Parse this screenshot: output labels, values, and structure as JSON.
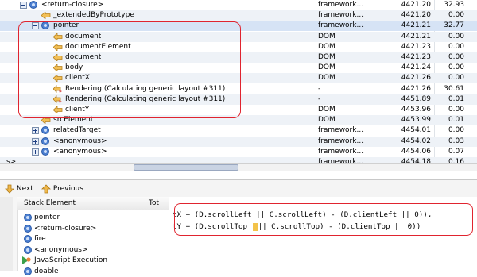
{
  "tree": {
    "rows": [
      {
        "level": 1,
        "expander": "minus",
        "icon": "function",
        "name": "<return-closure>",
        "type": "framework....",
        "time": "4421.20",
        "pct": "32.93",
        "alt": false
      },
      {
        "level": 2,
        "expander": "none",
        "icon": "arrow",
        "name": "_extendedByPrototype",
        "type": "framework....",
        "time": "4421.20",
        "pct": "0.00",
        "alt": true
      },
      {
        "level": 2,
        "expander": "minus",
        "icon": "function",
        "name": "pointer",
        "type": "framework....",
        "time": "4421.21",
        "pct": "32.77",
        "alt": false,
        "sel": true
      },
      {
        "level": 3,
        "expander": "none",
        "icon": "arrow",
        "name": "document",
        "type": "DOM",
        "time": "4421.21",
        "pct": "0.00",
        "alt": true
      },
      {
        "level": 3,
        "expander": "none",
        "icon": "arrow",
        "name": "documentElement",
        "type": "DOM",
        "time": "4421.23",
        "pct": "0.00",
        "alt": false
      },
      {
        "level": 3,
        "expander": "none",
        "icon": "arrow",
        "name": "document",
        "type": "DOM",
        "time": "4421.23",
        "pct": "0.00",
        "alt": true
      },
      {
        "level": 3,
        "expander": "none",
        "icon": "arrow",
        "name": "body",
        "type": "DOM",
        "time": "4421.24",
        "pct": "0.00",
        "alt": false
      },
      {
        "level": 3,
        "expander": "none",
        "icon": "arrow",
        "name": "clientX",
        "type": "DOM",
        "time": "4421.26",
        "pct": "0.00",
        "alt": true
      },
      {
        "level": 3,
        "expander": "none",
        "icon": "render",
        "name": "Rendering (Calculating generic layout #311)",
        "type": "-",
        "time": "4421.26",
        "pct": "30.61",
        "alt": false
      },
      {
        "level": 3,
        "expander": "none",
        "icon": "render",
        "name": "Rendering (Calculating generic layout #311)",
        "type": "-",
        "time": "4451.89",
        "pct": "0.01",
        "alt": true
      },
      {
        "level": 3,
        "expander": "none",
        "icon": "arrow",
        "name": "clientY",
        "type": "DOM",
        "time": "4453.96",
        "pct": "0.00",
        "alt": false
      },
      {
        "level": 2,
        "expander": "none",
        "icon": "arrow",
        "name": "srcElement",
        "type": "DOM",
        "time": "4453.99",
        "pct": "0.01",
        "alt": true
      },
      {
        "level": 2,
        "expander": "plus",
        "icon": "function",
        "name": "relatedTarget",
        "type": "framework....",
        "time": "4454.01",
        "pct": "0.00",
        "alt": false
      },
      {
        "level": 2,
        "expander": "plus",
        "icon": "function",
        "name": "<anonymous>",
        "type": "framework....",
        "time": "4454.02",
        "pct": "0.03",
        "alt": true
      },
      {
        "level": 2,
        "expander": "plus",
        "icon": "function",
        "name": "<anonymous>",
        "type": "framework....",
        "time": "4454.06",
        "pct": "0.07",
        "alt": false
      },
      {
        "level": 0,
        "expander": "none",
        "icon": "none",
        "name": "s>",
        "type": "framework....",
        "time": "4454.18",
        "pct": "0.16",
        "alt": true
      }
    ]
  },
  "toolbar": {
    "next_label": "Next",
    "previous_label": "Previous"
  },
  "stack": {
    "header_element": "Stack Element",
    "header_total": "Tot",
    "items": [
      {
        "icon": "function",
        "label": "pointer"
      },
      {
        "icon": "function",
        "label": "<return-closure>"
      },
      {
        "icon": "function",
        "label": "fire"
      },
      {
        "icon": "function",
        "label": "<anonymous>"
      },
      {
        "icon": "js-exec",
        "label": "JavaScript Execution"
      },
      {
        "icon": "function",
        "label": "doable"
      }
    ]
  },
  "code": {
    "line1": "tX + (D.scrollLeft || C.scrollLeft) - (D.clientLeft || 0)),",
    "line2_a": "tY + (D.scrollTop ",
    "line2_b": "|| C.scrollTop) - (D.clientTop || 0))"
  },
  "colors": {
    "highlight": "#e0242f",
    "function_icon": "#4c7fd0",
    "arrow_icon": "#e8a93a"
  }
}
